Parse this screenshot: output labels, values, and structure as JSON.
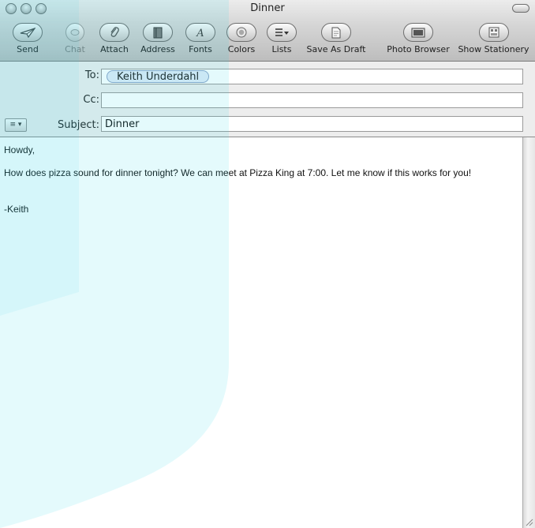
{
  "window": {
    "title": "Dinner"
  },
  "toolbar": {
    "items": [
      {
        "label": "Send",
        "icon": "send-icon"
      },
      {
        "label": "Chat",
        "icon": "chat-icon"
      },
      {
        "label": "Attach",
        "icon": "paperclip-icon"
      },
      {
        "label": "Address",
        "icon": "address-book-icon"
      },
      {
        "label": "Fonts",
        "icon": "fonts-icon"
      },
      {
        "label": "Colors",
        "icon": "color-wheel-icon"
      },
      {
        "label": "Lists",
        "icon": "list-icon"
      },
      {
        "label": "Save As Draft",
        "icon": "draft-icon"
      },
      {
        "label": "Photo Browser",
        "icon": "photo-browser-icon"
      },
      {
        "label": "Show Stationery",
        "icon": "stationery-icon"
      }
    ]
  },
  "header": {
    "to_label": "To:",
    "to_recipients": [
      "Keith Underdahl"
    ],
    "cc_label": "Cc:",
    "cc_value": "",
    "subject_label": "Subject:",
    "subject_value": "Dinner",
    "account_menu": "≡ ▾"
  },
  "body": {
    "lines": [
      "Howdy,",
      "How does pizza sound for dinner tonight? We can meet at Pizza King at 7:00. Let me know if this works for you!",
      "-Keith"
    ]
  },
  "colors": {
    "watermark": "#21d2e6",
    "toolbar_top": "#ececec",
    "toolbar_bottom": "#bdbdbd",
    "token_fill": "#e2ebf8"
  }
}
